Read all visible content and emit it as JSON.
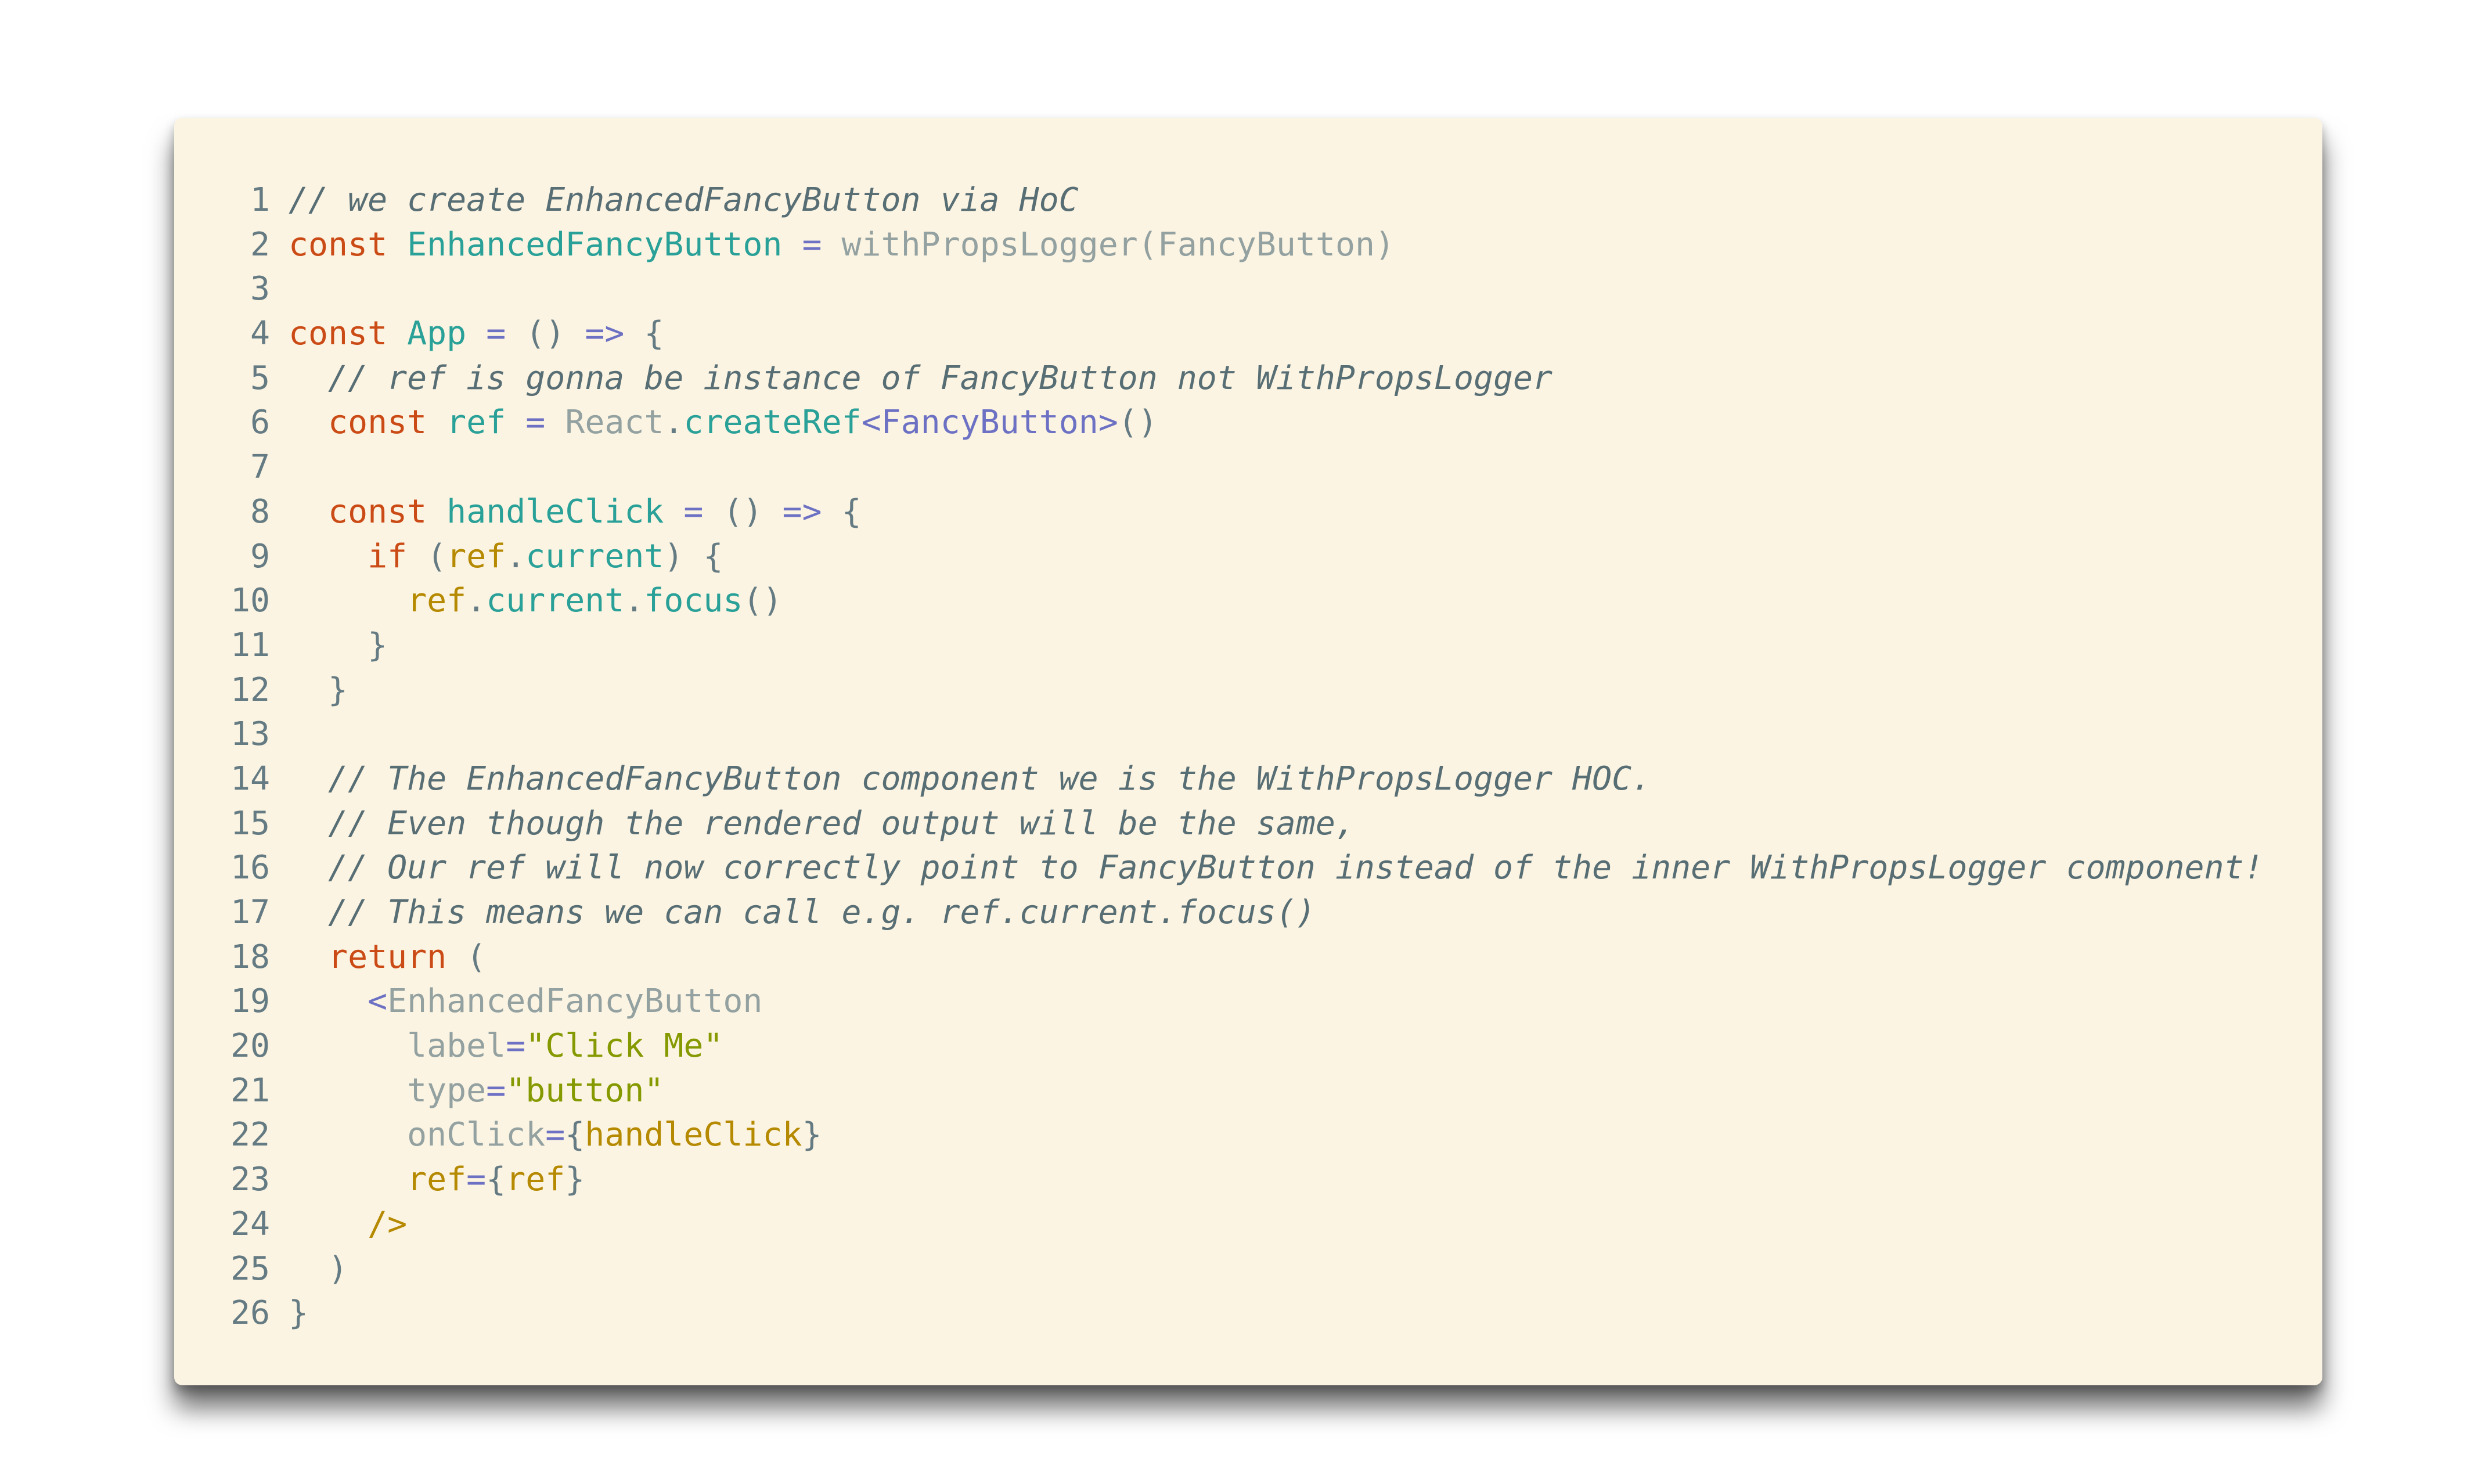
{
  "colors": {
    "background": "#fcf4e2",
    "keyword": "#cb4b16",
    "definition": "#2aa198",
    "comment": "#586e75",
    "operator": "#6c71c4",
    "variable": "#b58900",
    "string": "#859900",
    "muted": "#93a1a1"
  },
  "lines": [
    {
      "n": "1",
      "tokens": [
        {
          "t": "// we create EnhancedFancyButton via HoC",
          "c": "cmt"
        }
      ]
    },
    {
      "n": "2",
      "tokens": [
        {
          "t": "const",
          "c": "kw"
        },
        {
          "t": " "
        },
        {
          "t": "EnhancedFancyButton",
          "c": "def"
        },
        {
          "t": " "
        },
        {
          "t": "=",
          "c": "op"
        },
        {
          "t": " "
        },
        {
          "t": "withPropsLogger",
          "c": "call"
        },
        {
          "t": "(",
          "c": "call"
        },
        {
          "t": "FancyButton",
          "c": "call"
        },
        {
          "t": ")",
          "c": "call"
        }
      ]
    },
    {
      "n": "3",
      "tokens": []
    },
    {
      "n": "4",
      "tokens": [
        {
          "t": "const",
          "c": "kw"
        },
        {
          "t": " "
        },
        {
          "t": "App",
          "c": "def"
        },
        {
          "t": " "
        },
        {
          "t": "=",
          "c": "op"
        },
        {
          "t": " "
        },
        {
          "t": "()",
          "c": "punc"
        },
        {
          "t": " "
        },
        {
          "t": "=>",
          "c": "op"
        },
        {
          "t": " "
        },
        {
          "t": "{",
          "c": "punc"
        }
      ]
    },
    {
      "n": "5",
      "tokens": [
        {
          "t": "  "
        },
        {
          "t": "// ref is gonna be instance of FancyButton not WithPropsLogger",
          "c": "cmt"
        }
      ]
    },
    {
      "n": "6",
      "tokens": [
        {
          "t": "  "
        },
        {
          "t": "const",
          "c": "kw"
        },
        {
          "t": " "
        },
        {
          "t": "ref",
          "c": "def"
        },
        {
          "t": " "
        },
        {
          "t": "=",
          "c": "op"
        },
        {
          "t": " "
        },
        {
          "t": "React",
          "c": "call"
        },
        {
          "t": ".",
          "c": "punc"
        },
        {
          "t": "createRef",
          "c": "prop"
        },
        {
          "t": "<",
          "c": "op"
        },
        {
          "t": "FancyButton",
          "c": "op"
        },
        {
          "t": ">",
          "c": "op"
        },
        {
          "t": "()",
          "c": "punc"
        }
      ]
    },
    {
      "n": "7",
      "tokens": []
    },
    {
      "n": "8",
      "tokens": [
        {
          "t": "  "
        },
        {
          "t": "const",
          "c": "kw"
        },
        {
          "t": " "
        },
        {
          "t": "handleClick",
          "c": "def"
        },
        {
          "t": " "
        },
        {
          "t": "=",
          "c": "op"
        },
        {
          "t": " "
        },
        {
          "t": "()",
          "c": "punc"
        },
        {
          "t": " "
        },
        {
          "t": "=>",
          "c": "op"
        },
        {
          "t": " "
        },
        {
          "t": "{",
          "c": "punc"
        }
      ]
    },
    {
      "n": "9",
      "tokens": [
        {
          "t": "    "
        },
        {
          "t": "if",
          "c": "kw"
        },
        {
          "t": " "
        },
        {
          "t": "(",
          "c": "punc"
        },
        {
          "t": "ref",
          "c": "var"
        },
        {
          "t": ".",
          "c": "punc"
        },
        {
          "t": "current",
          "c": "prop"
        },
        {
          "t": ")",
          "c": "punc"
        },
        {
          "t": " "
        },
        {
          "t": "{",
          "c": "punc"
        }
      ]
    },
    {
      "n": "10",
      "tokens": [
        {
          "t": "      "
        },
        {
          "t": "ref",
          "c": "var"
        },
        {
          "t": ".",
          "c": "punc"
        },
        {
          "t": "current",
          "c": "prop"
        },
        {
          "t": ".",
          "c": "punc"
        },
        {
          "t": "focus",
          "c": "prop"
        },
        {
          "t": "()",
          "c": "punc"
        }
      ]
    },
    {
      "n": "11",
      "tokens": [
        {
          "t": "    "
        },
        {
          "t": "}",
          "c": "punc"
        }
      ]
    },
    {
      "n": "12",
      "tokens": [
        {
          "t": "  "
        },
        {
          "t": "}",
          "c": "punc"
        }
      ]
    },
    {
      "n": "13",
      "tokens": []
    },
    {
      "n": "14",
      "tokens": [
        {
          "t": "  "
        },
        {
          "t": "// The EnhancedFancyButton component we is the WithPropsLogger HOC.",
          "c": "cmt"
        }
      ]
    },
    {
      "n": "15",
      "tokens": [
        {
          "t": "  "
        },
        {
          "t": "// Even though the rendered output will be the same,",
          "c": "cmt"
        }
      ]
    },
    {
      "n": "16",
      "tokens": [
        {
          "t": "  "
        },
        {
          "t": "// Our ref will now correctly point to FancyButton instead of the inner WithPropsLogger component!",
          "c": "cmt"
        }
      ]
    },
    {
      "n": "17",
      "tokens": [
        {
          "t": "  "
        },
        {
          "t": "// This means we can call e.g. ref.current.focus()",
          "c": "cmt"
        }
      ]
    },
    {
      "n": "18",
      "tokens": [
        {
          "t": "  "
        },
        {
          "t": "return",
          "c": "kw"
        },
        {
          "t": " "
        },
        {
          "t": "(",
          "c": "punc"
        }
      ]
    },
    {
      "n": "19",
      "tokens": [
        {
          "t": "    "
        },
        {
          "t": "<",
          "c": "ta"
        },
        {
          "t": "EnhancedFancyButton",
          "c": "tag"
        }
      ]
    },
    {
      "n": "20",
      "tokens": [
        {
          "t": "      "
        },
        {
          "t": "label",
          "c": "attr"
        },
        {
          "t": "=",
          "c": "op"
        },
        {
          "t": "\"Click Me\"",
          "c": "str"
        }
      ]
    },
    {
      "n": "21",
      "tokens": [
        {
          "t": "      "
        },
        {
          "t": "type",
          "c": "attr"
        },
        {
          "t": "=",
          "c": "op"
        },
        {
          "t": "\"button\"",
          "c": "str"
        }
      ]
    },
    {
      "n": "22",
      "tokens": [
        {
          "t": "      "
        },
        {
          "t": "onClick",
          "c": "attr"
        },
        {
          "t": "=",
          "c": "op"
        },
        {
          "t": "{",
          "c": "punc"
        },
        {
          "t": "handleClick",
          "c": "var"
        },
        {
          "t": "}",
          "c": "punc"
        }
      ]
    },
    {
      "n": "23",
      "tokens": [
        {
          "t": "      "
        },
        {
          "t": "ref",
          "c": "var"
        },
        {
          "t": "=",
          "c": "op"
        },
        {
          "t": "{",
          "c": "punc"
        },
        {
          "t": "ref",
          "c": "var"
        },
        {
          "t": "}",
          "c": "punc"
        }
      ]
    },
    {
      "n": "24",
      "tokens": [
        {
          "t": "    "
        },
        {
          "t": "/>",
          "c": "cls"
        }
      ]
    },
    {
      "n": "25",
      "tokens": [
        {
          "t": "  "
        },
        {
          "t": ")",
          "c": "punc"
        }
      ]
    },
    {
      "n": "26",
      "tokens": [
        {
          "t": "}",
          "c": "punc"
        }
      ]
    }
  ]
}
